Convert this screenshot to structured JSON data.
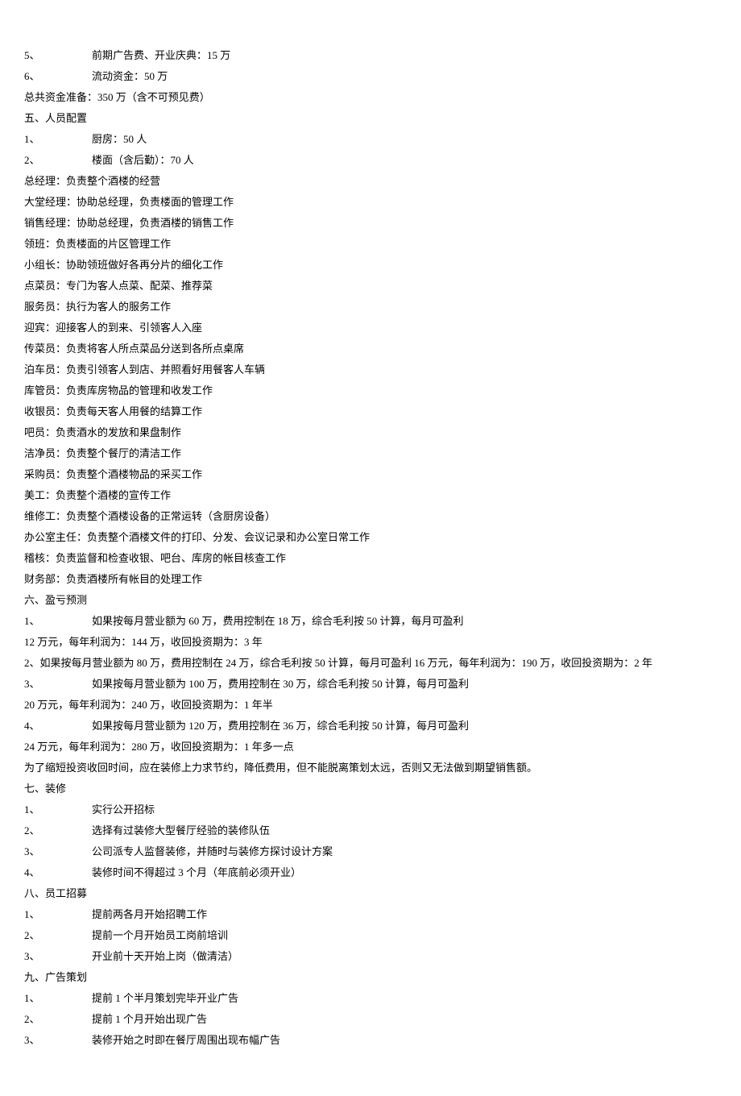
{
  "lines": [
    {
      "type": "numidx",
      "num": "5、",
      "text": "前期广告费、开业庆典：15 万"
    },
    {
      "type": "numidx",
      "num": "6、",
      "text": "流动资金：50 万"
    },
    {
      "type": "plain",
      "text": "总共资金准备：350 万（含不可预见费）"
    },
    {
      "type": "plain",
      "text": "五、人员配置"
    },
    {
      "type": "numidx",
      "num": "1、",
      "text": "厨房：50 人"
    },
    {
      "type": "numidx",
      "num": "2、",
      "text": "楼面（含后勤）：70 人"
    },
    {
      "type": "plain",
      "text": "总经理：负责整个酒楼的经营"
    },
    {
      "type": "plain",
      "text": "大堂经理：协助总经理，负责楼面的管理工作"
    },
    {
      "type": "plain",
      "text": "销售经理：协助总经理，负责酒楼的销售工作"
    },
    {
      "type": "plain",
      "text": "领班：负责楼面的片区管理工作"
    },
    {
      "type": "plain",
      "text": "小组长：协助领班做好各再分片的细化工作"
    },
    {
      "type": "plain",
      "text": "点菜员：专门为客人点菜、配菜、推荐菜"
    },
    {
      "type": "plain",
      "text": "服务员：执行为客人的服务工作"
    },
    {
      "type": "plain",
      "text": "迎宾：迎接客人的到来、引领客人入座"
    },
    {
      "type": "plain",
      "text": "传菜员：负责将客人所点菜品分送到各所点桌席"
    },
    {
      "type": "plain",
      "text": "泊车员：负责引领客人到店、并照看好用餐客人车辆"
    },
    {
      "type": "plain",
      "text": "库管员：负责库房物品的管理和收发工作"
    },
    {
      "type": "plain",
      "text": "收银员：负责每天客人用餐的结算工作"
    },
    {
      "type": "plain",
      "text": "吧员：负责酒水的发放和果盘制作"
    },
    {
      "type": "plain",
      "text": "洁净员：负责整个餐厅的清洁工作"
    },
    {
      "type": "plain",
      "text": "采购员：负责整个酒楼物品的采买工作"
    },
    {
      "type": "plain",
      "text": "美工：负责整个酒楼的宣传工作"
    },
    {
      "type": "plain",
      "text": "维修工：负责整个酒楼设备的正常运转（含厨房设备）"
    },
    {
      "type": "plain",
      "text": "办公室主任：负责整个酒楼文件的打印、分发、会议记录和办公室日常工作"
    },
    {
      "type": "plain",
      "text": "稽核：负责监督和检查收银、吧台、库房的帐目核查工作"
    },
    {
      "type": "plain",
      "text": "财务部：负责酒楼所有帐目的处理工作"
    },
    {
      "type": "plain",
      "text": "六、盈亏预测"
    },
    {
      "type": "numidx",
      "num": "1、",
      "text": "如果按每月营业额为 60 万，费用控制在 18 万，综合毛利按 50 计算，每月可盈利"
    },
    {
      "type": "plain",
      "text": "12 万元，每年利润为：144 万，收回投资期为：3 年"
    },
    {
      "type": "plain",
      "text": "2、如果按每月营业额为 80 万，费用控制在 24 万，综合毛利按 50 计算，每月可盈利 16 万元，每年利润为：190 万，收回投资期为：2 年"
    },
    {
      "type": "numidx",
      "num": "3、",
      "text": "如果按每月营业额为 100 万，费用控制在 30 万，综合毛利按 50 计算，每月可盈利"
    },
    {
      "type": "plain",
      "text": "20 万元，每年利润为：240 万，收回投资期为：1 年半"
    },
    {
      "type": "numidx",
      "num": "4、",
      "text": "如果按每月营业额为 120 万，费用控制在 36 万，综合毛利按 50 计算，每月可盈利"
    },
    {
      "type": "plain",
      "text": "24 万元，每年利润为：280 万，收回投资期为：1 年多一点"
    },
    {
      "type": "plain",
      "text": "为了缩短投资收回时间，应在装修上力求节约，降低费用，但不能脱离策划太远，否则又无法做到期望销售额。"
    },
    {
      "type": "plain",
      "text": "七、装修"
    },
    {
      "type": "numidx",
      "num": "1、",
      "text": "实行公开招标"
    },
    {
      "type": "numidx",
      "num": "2、",
      "text": "选择有过装修大型餐厅经验的装修队伍"
    },
    {
      "type": "numidx",
      "num": "3、",
      "text": "公司派专人监督装修，并随时与装修方探讨设计方案"
    },
    {
      "type": "numidx",
      "num": "4、",
      "text": "装修时间不得超过 3 个月（年底前必须开业）"
    },
    {
      "type": "plain",
      "text": "八、员工招募"
    },
    {
      "type": "numidx",
      "num": "1、",
      "text": "提前两各月开始招聘工作"
    },
    {
      "type": "numidx",
      "num": "2、",
      "text": "提前一个月开始员工岗前培训"
    },
    {
      "type": "numidx",
      "num": "3、",
      "text": "开业前十天开始上岗（做清洁）"
    },
    {
      "type": "plain",
      "text": "九、广告策划"
    },
    {
      "type": "numidx",
      "num": "1、",
      "text": "提前 1 个半月策划完毕开业广告"
    },
    {
      "type": "numidx",
      "num": "2、",
      "text": "提前 1 个月开始出现广告"
    },
    {
      "type": "numidx",
      "num": "3、",
      "text": "装修开始之时即在餐厅周围出现布幅广告"
    }
  ]
}
